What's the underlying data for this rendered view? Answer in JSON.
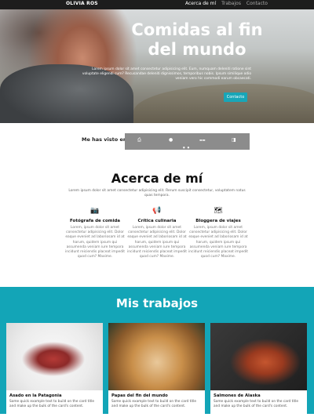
{
  "navbar": {
    "brand": "OLIVIA ROS",
    "links": [
      "Acerca de mí",
      "Trabajos",
      "Contacto"
    ]
  },
  "hero": {
    "title": "Comidas al fin del mundo",
    "text": "Lorem ipsum dolor sit amet consectetur adipisicing elit. Eum, numquam deleniti ratione sint voluptate eligendi cum? Recusandae deleniti dignissimos, temporibus nobis. Ipsum similique odio veniam vero hic commodi earum obcaecati.",
    "button": "Contacto"
  },
  "seen_on": {
    "label": "Me has visto en:",
    "logos": [
      "hp-icon",
      "apple-icon",
      "brand-logo",
      "partner-icon"
    ]
  },
  "about": {
    "title": "Acerca de mí",
    "intro": "Lorem ipsum dolor sit amet consectetur adipisicing elit. Rerum suscipit consectetur, voluptatem natus quas tempora.",
    "features": [
      {
        "icon": "camera-icon",
        "glyph": "📷",
        "title": "Fotógrafa de comida",
        "text": "Lorem, ipsum dolor sit amet consectetur adipisicing elit. Dolor eaque eveniet ad laboriosam id at harum, quidem ipsum qui assumenda veniam iure tempora incidunt reiciendis placeat impedit quod cum? Maxime."
      },
      {
        "icon": "megaphone-icon",
        "glyph": "📢",
        "title": "Crítica culinaria",
        "text": "Lorem, ipsum dolor sit amet consectetur adipisicing elit. Dolor eaque eveniet ad laboriosam id at harum, quidem ipsum qui assumenda veniam iure tempora incidunt reiciendis placeat impedit quod cum? Maxime."
      },
      {
        "icon": "map-icon",
        "glyph": "🗺",
        "title": "Bloggera de viajes",
        "text": "Lorem, ipsum dolor sit amet consectetur adipisicing elit. Dolor eaque eveniet ad laboriosam id at harum, quidem ipsum qui assumenda veniam iure tempora incidunt reiciendis placeat impedit quod cum? Maxime."
      }
    ]
  },
  "works": {
    "title": "Mis trabajos",
    "cards": [
      {
        "title": "Asado en la Patagonia",
        "text": "Some quick example text to build on the card title and make up the bulk of the card's content."
      },
      {
        "title": "Papas del fin del mundo",
        "text": "Some quick example text to build on the card title and make up the bulk of the card's content."
      },
      {
        "title": "Salmones de Alaska",
        "text": "Some quick example text to build on the card title and make up the bulk of the card's content."
      }
    ]
  },
  "colors": {
    "accent": "#13a5b7",
    "navbar": "#1d1d1d",
    "carousel": "#8c8c8c"
  }
}
